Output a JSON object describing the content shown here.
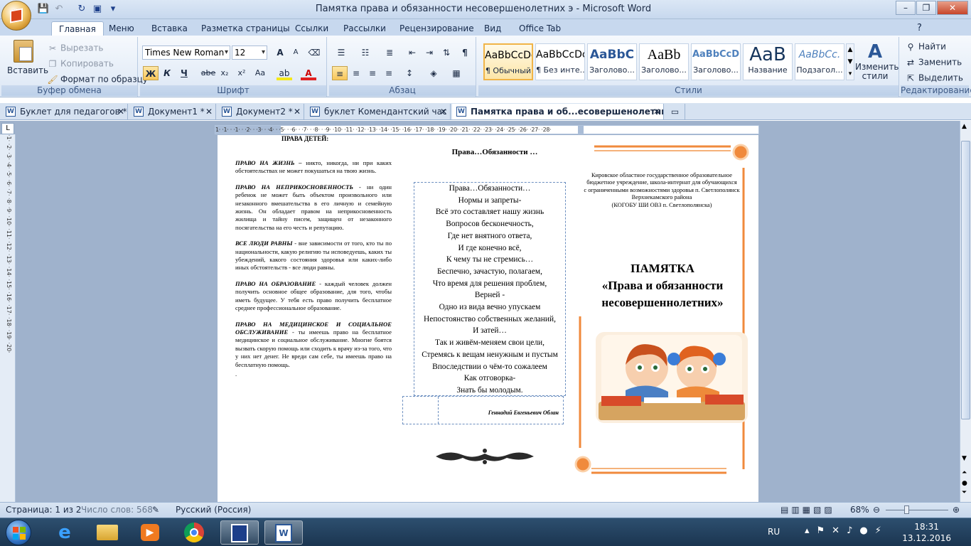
{
  "window": {
    "title": "Памятка права и обязанности несовершенолетних э - Microsoft Word",
    "minimize": "–",
    "restore": "❐",
    "close": "✕"
  },
  "ribbon_tabs": [
    "Главная",
    "Меню",
    "Вставка",
    "Разметка страницы",
    "Ссылки",
    "Рассылки",
    "Рецензирование",
    "Вид",
    "Office Tab"
  ],
  "clipboard": {
    "paste": "Вставить",
    "cut": "Вырезать",
    "copy": "Копировать",
    "format_painter": "Формат по образцу",
    "label": "Буфер обмена"
  },
  "font": {
    "name": "Times New Roman",
    "size": "12",
    "label": "Шрифт",
    "bold": "Ж",
    "italic": "К",
    "underline": "Ч",
    "strike": "abe",
    "sub": "x₂",
    "sup": "x²",
    "case": "Aa",
    "grow": "A",
    "shrink": "A"
  },
  "paragraph": {
    "label": "Абзац"
  },
  "styles": {
    "label": "Стили",
    "items": [
      {
        "preview": "AaBbCcDć",
        "name": "¶ Обычный"
      },
      {
        "preview": "AaBbCcDć",
        "name": "¶ Без инте..."
      },
      {
        "preview": "AaBbC",
        "name": "Заголово..."
      },
      {
        "preview": "AaBb",
        "name": "Заголово..."
      },
      {
        "preview": "AaBbCcD",
        "name": "Заголово..."
      },
      {
        "preview": "AaB",
        "name": "Название"
      },
      {
        "preview": "AaBbCc.",
        "name": "Подзагол..."
      }
    ],
    "change": "Изменить стили"
  },
  "editing": {
    "find": "Найти",
    "replace": "Заменить",
    "select": "Выделить",
    "label": "Редактирование"
  },
  "doc_tabs": [
    {
      "label": "Буклет для педагогов *"
    },
    {
      "label": "Документ1 *"
    },
    {
      "label": "Документ2 *"
    },
    {
      "label": "буклет Комендантский час"
    },
    {
      "label": "Памятка права и об...есовершенолетних э"
    }
  ],
  "ruler": "1· ·1· · ·1· · ·2· · ·3· · ·4· · ·5· · ·6· · ·7· · ·8· · ·9· ·10· ·11· ·12· ·13· ·14· ·15· ·16· ·17· ·18· ·19· ·20· ·21· ·22· ·23· ·24· ·25· ·26· ·27· ·28·",
  "vruler": "·1· ·2· ·3· ·4· ·5· ·6· ·7· ·8· ·9· ·10· ·11· ·12· ·13· ·14· ·15· ·16· ·17· ·18· ·19· ·20·",
  "doc": {
    "col1_heading": "ПРАВА ДЕТЕЙ:",
    "rights": [
      {
        "title": "ПРАВО НА ЖИЗНЬ –",
        "text": " никто, никогда, ни при каких обстоятельствах не может покушаться на твою жизнь."
      },
      {
        "title": "ПРАВО НА НЕПРИКОСНОВЕННОСТЬ",
        "text": " - ни один ребенок не может быть объектом произвольного или незаконного вмешательства в его личную и семейную жизнь. Он обладает правом на неприкосновенность жилища и тайну писем, защищен от незаконного посягательства на его честь и репутацию."
      },
      {
        "title": "ВСЕ ЛЮДИ РАВНЫ",
        "text": " - вне зависимости от того, кто ты по национальности, какую религию ты исповедуешь, каких ты убеждений, какого состояния здоровья или каких-либо иных обстоятельств - все люди равны."
      },
      {
        "title": "ПРАВО НА ОБРАЗОВАНИЕ",
        "text": " - каждый человек должен получить основное общее образование, для того, чтобы иметь будущее. У тебя есть право получить бесплатное среднее профессиональное образование."
      },
      {
        "title": "ПРАВО НА МЕДИЦИНСКОЕ И СОЦИАЛЬНОЕ ОБСЛУЖИВАНИЕ",
        "text": " - ты имеешь право на бесплатное медицинское и социальное обслуживание. Многие боятся вызвать скорую помощь или сходить к врачу из-за того, что у них нет денег. Не вреди сам себе, ты имеешь право на бесплатную помощь."
      }
    ],
    "trailing_dot": ".",
    "poem_title": "Права…Обязанности …",
    "poem": [
      "Права…Обязанности…",
      "Нормы и запреты-",
      "Всё это составляет нашу жизнь",
      "Вопросов бесконечность,",
      "Где нет внятного ответа,",
      "И где конечно всё,",
      "К чему ты не стремись…",
      "Беспечно, зачастую, полагаем,",
      "Что время для решения проблем,",
      "Верней -",
      "Одно из вида вечно упускаем",
      "Непостоянство собственных желаний,",
      "И затей…",
      "Так и живём-меняем свои цели,",
      "Стремясь к вещам ненужным и пустым",
      "Впоследствии о чём-то сожалеем",
      "Как отговорка-",
      "Знать бы молодым."
    ],
    "author": "Геннадий Евгеньевич Облан",
    "school": [
      "Кировское областное государственное образовательное",
      "бюджетное учреждение, школа-интернат для обучающихся",
      "с ограниченными возможностями здоровья п. Светлополянск",
      "Верхнекамского района",
      "(КОГОБУ ШИ ОВЗ п. Светлополянска)"
    ],
    "pamphlet_title": [
      "ПАМЯТКА",
      "«Права и обязанности",
      "несовершеннолетних»"
    ]
  },
  "status": {
    "page": "Страница: 1 из 2",
    "words": "Число слов: 568",
    "lang": "Русский (Россия)",
    "zoom": "68%"
  },
  "taskbar": {
    "lang": "RU",
    "time": "18:31",
    "date": "13.12.2016"
  },
  "colors": {
    "accent": "#f08a3c",
    "ribbon": "#dce7f5",
    "workspace": "#9fb2cc"
  }
}
